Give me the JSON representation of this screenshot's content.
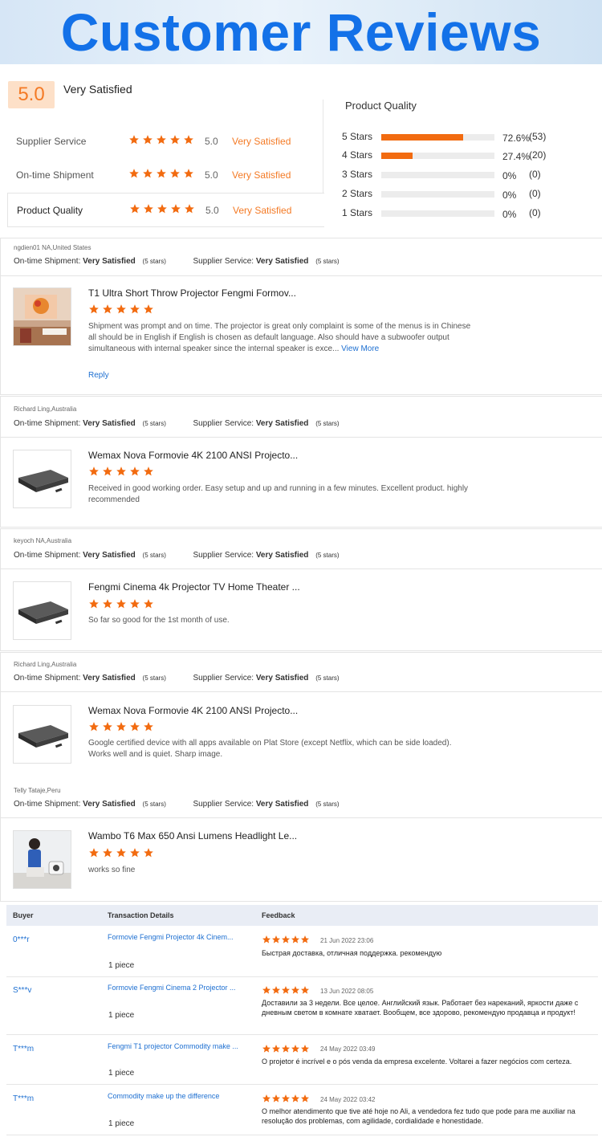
{
  "banner": {
    "title": "Customer Reviews"
  },
  "overall": {
    "score": "5.0",
    "label": "Very Satisfied"
  },
  "ratings": [
    {
      "name": "Supplier Service",
      "score": "5.0",
      "text": "Very Satisfied",
      "stars": 5
    },
    {
      "name": "On-time Shipment",
      "score": "5.0",
      "text": "Very Satisfied",
      "stars": 5
    },
    {
      "name": "Product Quality",
      "score": "5.0",
      "text": "Very Satisfied",
      "stars": 5
    }
  ],
  "product_quality": {
    "title": "Product Quality",
    "rows": [
      {
        "label": "5 Stars",
        "fraction": 0.726,
        "pct": "72.6%",
        "count": "(53)"
      },
      {
        "label": "4 Stars",
        "fraction": 0.274,
        "pct": "27.4%",
        "count": "(20)"
      },
      {
        "label": "3 Stars",
        "fraction": 0,
        "pct": "0%",
        "count": "(0)"
      },
      {
        "label": "2 Stars",
        "fraction": 0,
        "pct": "0%",
        "count": "(0)"
      },
      {
        "label": "1 Stars",
        "fraction": 0,
        "pct": "0%",
        "count": "(0)"
      }
    ]
  },
  "meta_labels": {
    "shipment": "On-time Shipment:",
    "service": "Supplier Service:",
    "very_satisfied": "Very Satisfied",
    "five_stars": "(5 stars)",
    "view_more": "View More",
    "reply": "Reply"
  },
  "reviews": [
    {
      "user": "ngdien01 NA,United States",
      "title": "T1 Ultra Short Throw Projector Fengmi Formov...",
      "text": "Shipment was prompt and on time.  The projector is great only complaint is some of the menus is in Chinese all should be in English if English is chosen as default language.  Also should have a subwoofer output simultaneous with internal speaker since the internal speaker is exce... ",
      "thumb": "projector-wall-image"
    },
    {
      "user": "Richard Ling,Australia",
      "title": "Wemax Nova Formovie 4K 2100 ANSI Projecto...",
      "text": "Received in good working order.  Easy setup and up and running in a few minutes.  Excellent product.  highly recommended",
      "thumb": "projector-black-image"
    },
    {
      "user": "keyoch NA,Australia",
      "title": "Fengmi Cinema 4k Projector TV Home Theater ...",
      "text": "So far so good for the 1st month of use.",
      "thumb": "projector-black-image"
    },
    {
      "user": "Richard Ling,Australia",
      "title": "Wemax Nova Formovie 4K 2100 ANSI Projecto...",
      "text": "Google certified device with all apps available on Plat Store (except Netflix, which can be side loaded).  Works well and is quiet.  Sharp image.",
      "thumb": "projector-black-image"
    },
    {
      "user": "Telly Tataje,Peru",
      "title": "Wambo T6 Max 650 Ansi Lumens Headlight Le...",
      "text": "works so fine",
      "thumb": "woman-with-projector-image"
    }
  ],
  "table": {
    "headers": {
      "buyer": "Buyer",
      "transaction": "Transaction Details",
      "feedback": "Feedback"
    },
    "rows": [
      {
        "buyer": "0***r",
        "product": "Formovie Fengmi Projector 4k Cinem...",
        "qty": "1 piece",
        "date": "21 Jun 2022 23:06",
        "feedback": "Быстрая доставка, отличная поддержка. рекомендую"
      },
      {
        "buyer": "S***v",
        "product": "Formovie Fengmi Cinema 2 Projector ...",
        "qty": "1 piece",
        "date": "13 Jun 2022 08:05",
        "feedback": "Доставили за 3 недели. Все целое. Английский язык. Работает без нареканий, яркости даже с дневным светом в комнате хватает. Вообщем, все здорово, рекомендую продавца и продукт!"
      },
      {
        "buyer": "T***m",
        "product": "Fengmi T1 projector Commodity make ...",
        "qty": "1 piece",
        "date": "24 May 2022 03:49",
        "feedback": "O projetor é incrível e o pós venda da empresa excelente. Voltarei a fazer negócios com certeza."
      },
      {
        "buyer": "T***m",
        "product": "Commodity make up the difference",
        "qty": "1 piece",
        "date": "24 May 2022 03:42",
        "feedback": "O melhor atendimento que tive até hoje no Ali, a vendedora fez tudo que pode para me auxiliar na resolução dos problemas, com agilidade, cordialidade e honestidade."
      }
    ]
  },
  "colors": {
    "accent": "#f47a25",
    "bar_fill": "#f26b10",
    "link": "#1d6fd1",
    "banner_text": "#1371e8"
  }
}
